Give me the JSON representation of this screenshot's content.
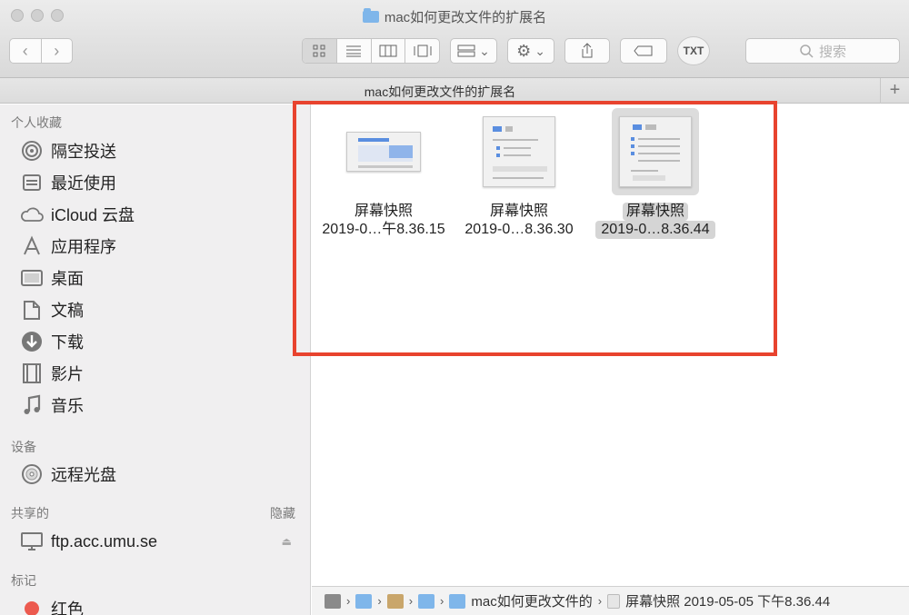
{
  "window": {
    "title": "mac如何更改文件的扩展名"
  },
  "toolbar": {
    "back_glyph": "‹",
    "forward_glyph": "›",
    "arrange_chevron": "⌄",
    "action_chevron": "⌄",
    "txt_label": "TXT",
    "search_placeholder": "搜索"
  },
  "tabbar": {
    "title": "mac如何更改文件的扩展名",
    "add_glyph": "+"
  },
  "sidebar": {
    "favorites_header": "个人收藏",
    "favorites": [
      {
        "label": "隔空投送",
        "icon": "airdrop-icon"
      },
      {
        "label": "最近使用",
        "icon": "recents-icon"
      },
      {
        "label": "iCloud 云盘",
        "icon": "cloud-icon"
      },
      {
        "label": "应用程序",
        "icon": "applications-icon"
      },
      {
        "label": "桌面",
        "icon": "desktop-icon"
      },
      {
        "label": "文稿",
        "icon": "documents-icon"
      },
      {
        "label": "下载",
        "icon": "downloads-icon"
      },
      {
        "label": "影片",
        "icon": "movies-icon"
      },
      {
        "label": "音乐",
        "icon": "music-icon"
      }
    ],
    "devices_header": "设备",
    "devices": [
      {
        "label": "远程光盘",
        "icon": "disc-icon"
      }
    ],
    "shared_header": "共享的",
    "shared_hide": "隐藏",
    "shared": [
      {
        "label": "ftp.acc.umu.se",
        "icon": "server-icon"
      }
    ],
    "tags_header": "标记",
    "tags": [
      {
        "label": "红色",
        "color": "#ec5a4f"
      }
    ]
  },
  "files": [
    {
      "name": "屏幕快照",
      "date": "2019-0…午8.36.15",
      "selected": false
    },
    {
      "name": "屏幕快照",
      "date": "2019-0…8.36.30",
      "selected": false
    },
    {
      "name": "屏幕快照",
      "date": "2019-0…8.36.44",
      "selected": true
    }
  ],
  "pathbar": {
    "folder": "mac如何更改文件的",
    "file": "屏幕快照 2019-05-05 下午8.36.44"
  },
  "colors": {
    "highlight": "#e8432e",
    "folder": "#7fb6ea",
    "selection": "#d5d5d5"
  }
}
